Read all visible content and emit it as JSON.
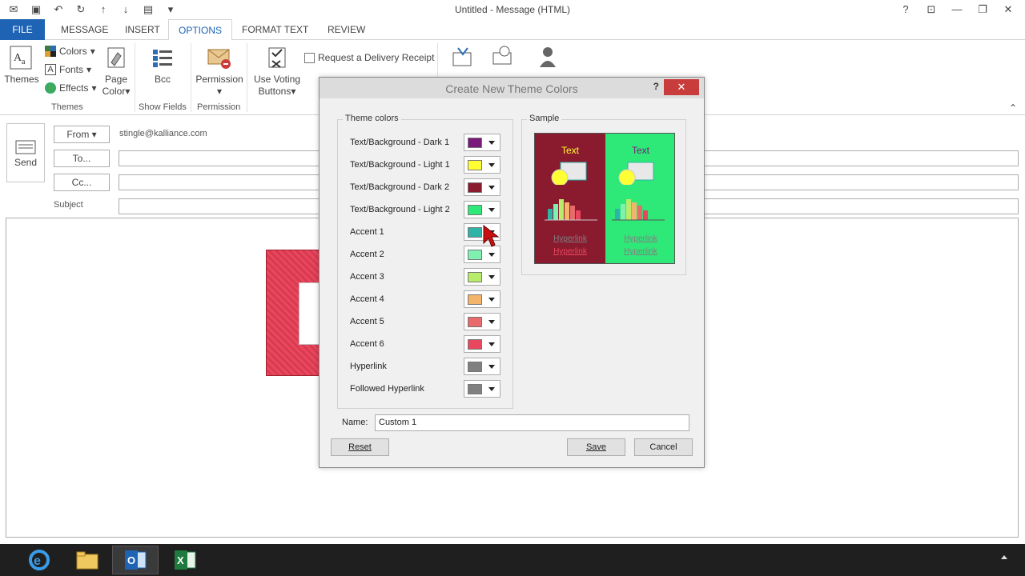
{
  "window": {
    "title": "Untitled - Message (HTML)"
  },
  "tabs": [
    {
      "label": "FILE"
    },
    {
      "label": "MESSAGE"
    },
    {
      "label": "INSERT"
    },
    {
      "label": "OPTIONS"
    },
    {
      "label": "FORMAT TEXT"
    },
    {
      "label": "REVIEW"
    }
  ],
  "ribbon": {
    "themes_label": "Themes",
    "colors_label": "Colors",
    "fonts_label": "Fonts",
    "effects_label": "Effects",
    "page_color_label_1": "Page",
    "page_color_label_2": "Color",
    "themes_group": "Themes",
    "bcc_label": "Bcc",
    "show_fields_group": "Show Fields",
    "permission_label": "Permission",
    "permission_group": "Permission",
    "voting_label_1": "Use Voting",
    "voting_label_2": "Buttons",
    "delivery_receipt": "Request a Delivery Receipt"
  },
  "compose": {
    "send_label": "Send",
    "from_label": "From",
    "from_address": "stingle@kalliance.com",
    "to_label": "To...",
    "cc_label": "Cc...",
    "subject_label": "Subject"
  },
  "dialog": {
    "title": "Create New Theme Colors",
    "help": "?",
    "theme_colors_legend": "Theme colors",
    "sample_legend": "Sample",
    "rows": [
      {
        "label": "Text/Background - Dark 1",
        "color": "#7a1a7a"
      },
      {
        "label": "Text/Background - Light 1",
        "color": "#ffff33"
      },
      {
        "label": "Text/Background - Dark 2",
        "color": "#8a1a2e"
      },
      {
        "label": "Text/Background - Light 2",
        "color": "#2ee878"
      },
      {
        "label": "Accent 1",
        "color": "#2fb3a6"
      },
      {
        "label": "Accent 2",
        "color": "#7ff0b0"
      },
      {
        "label": "Accent 3",
        "color": "#b8ec6a"
      },
      {
        "label": "Accent 4",
        "color": "#f4b56a"
      },
      {
        "label": "Accent 5",
        "color": "#e86a6a"
      },
      {
        "label": "Accent 6",
        "color": "#e8475e"
      },
      {
        "label": "Hyperlink",
        "color": "#808080"
      },
      {
        "label": "Followed Hyperlink",
        "color": "#808080"
      }
    ],
    "sample": {
      "text": "Text",
      "hyperlink": "Hyperlink",
      "followed": "Hyperlink"
    },
    "name_label": "Name:",
    "name_value": "Custom 1",
    "reset_label": "Reset",
    "save_label": "Save",
    "cancel_label": "Cancel"
  },
  "icons": {
    "help": "help-icon",
    "close": "close-icon"
  }
}
